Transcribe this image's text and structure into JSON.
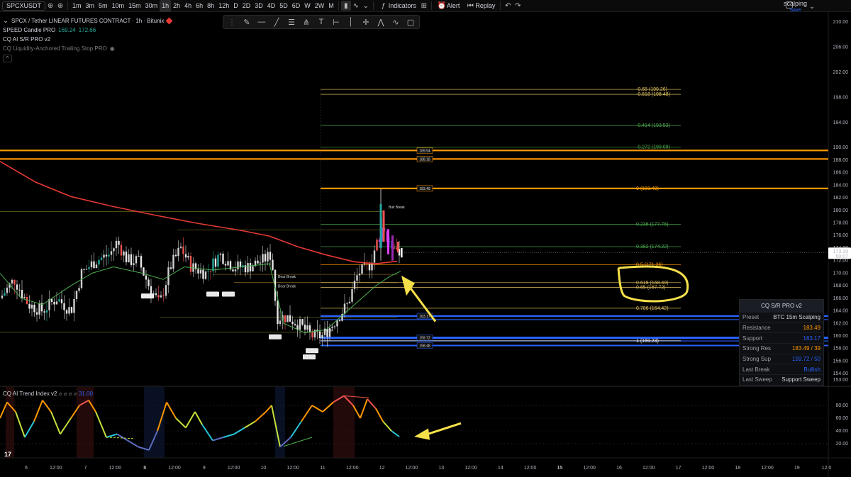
{
  "toolbar": {
    "symbol": "SPCXUSDT",
    "timeframes": [
      "1m",
      "3m",
      "5m",
      "10m",
      "15m",
      "30m",
      "1h",
      "2h",
      "4h",
      "6h",
      "8h",
      "12h",
      "D",
      "2D",
      "3D",
      "4D",
      "5D",
      "6D",
      "W",
      "2W",
      "M"
    ],
    "active_timeframe": "1h",
    "indicators_label": "Indicators",
    "alert_label": "Alert",
    "replay_label": "Replay",
    "layout_name": "scalping",
    "layout_status": "Save"
  },
  "legend": {
    "title": "SPCX / Tether LINEAR FUTURES CONTRACT · 1h · Bitunix",
    "ind1_name": "SPEED Candle PRO",
    "ind1_v1": "169.24",
    "ind1_v2": "172.66",
    "ind2_name": "CQ AI S/R PRO v2",
    "ind3_name": "CQ Liquidity-Anchored Trailing Stop PRO"
  },
  "price_axis": {
    "ticks": [
      "210.00",
      "206.00",
      "202.00",
      "198.00",
      "194.00",
      "190.00",
      "188.00",
      "186.00",
      "184.00",
      "182.00",
      "180.00",
      "178.00",
      "176.00",
      "174.00",
      "172.00",
      "170.00",
      "168.00",
      "166.00",
      "164.00",
      "162.00",
      "160.00",
      "158.00",
      "156.00",
      "154.00",
      "153.00"
    ],
    "current_price": "173.29",
    "countdown": "50:07",
    "osc_ticks": [
      "80.00",
      "60.00",
      "40.00",
      "20.00"
    ]
  },
  "time_axis": {
    "labels": [
      "6",
      "12:00",
      "7",
      "12:00",
      "8",
      "12:00",
      "9",
      "12:00",
      "10",
      "12:00",
      "11",
      "12:00",
      "12",
      "12:00",
      "13",
      "12:00",
      "14",
      "12:00",
      "15",
      "12:00",
      "16",
      "12:00",
      "17",
      "12:00",
      "18",
      "12:00",
      "19",
      "12:0"
    ]
  },
  "levels": {
    "fib": [
      {
        "label": "-0.65 (199.26)",
        "color": "#e0c060"
      },
      {
        "label": "-0.618 (198.48)",
        "color": "#e0c060"
      },
      {
        "label": "-0.414 (193.53)",
        "color": "#4caf50"
      },
      {
        "label": "-0.272 (190.09)",
        "color": "#4caf50"
      },
      {
        "label": "0 (183.49)",
        "color": "#ff9800"
      },
      {
        "label": "0.236 (177.76)",
        "color": "#4caf50"
      },
      {
        "label": "0.382 (174.22)",
        "color": "#4caf50"
      },
      {
        "label": "0.5 (171.36)",
        "color": "#ff9800"
      },
      {
        "label": "0.618 (168.49)",
        "color": "#e0c060"
      },
      {
        "label": "0.65 (167.72)",
        "color": "#e0c060"
      },
      {
        "label": "0.786 (164.42)",
        "color": "#e0c060"
      },
      {
        "label": "1 (159.23)",
        "color": "#ffffff"
      }
    ],
    "sr_tags": [
      "189.54",
      "188.18",
      "183.49",
      "163.17",
      "159.72",
      "158.48"
    ],
    "chart_tags": [
      "Bull Break",
      "Bear Break",
      "Bear Break",
      "Sweep",
      "Sweep",
      "Sweep",
      "Sweep",
      "Sweep",
      "Break"
    ]
  },
  "info_table": {
    "title": "CQ S/R PRO v2",
    "rows": [
      {
        "k": "Preset",
        "v": "BTC 15m Scalping",
        "color": "#d1d4dc"
      },
      {
        "k": "Resistance",
        "v": "183.49",
        "color": "#ff9800"
      },
      {
        "k": "Support",
        "v": "163.17",
        "color": "#2962ff"
      },
      {
        "k": "Strong Res",
        "v": "183.49 / 39",
        "color": "#ff9800"
      },
      {
        "k": "Strong Sup",
        "v": "159.72 / 50",
        "color": "#2962ff"
      },
      {
        "k": "Last Break",
        "v": "Bullish",
        "color": "#2962ff"
      },
      {
        "k": "Last Sweep",
        "v": "Support Sweep",
        "color": "#d1d4dc"
      }
    ]
  },
  "oscillator": {
    "name": "CQ AI Trend Index v2",
    "value": "31.00"
  },
  "colors": {
    "bg": "#000000",
    "bull": "#26a69a",
    "bear": "#ef5350",
    "ma_red": "#e53935",
    "trail_green": "#4caf50",
    "support_blue": "#2962ff",
    "resistance_orange": "#ff9800",
    "annotation_yellow": "#f5e04a"
  }
}
